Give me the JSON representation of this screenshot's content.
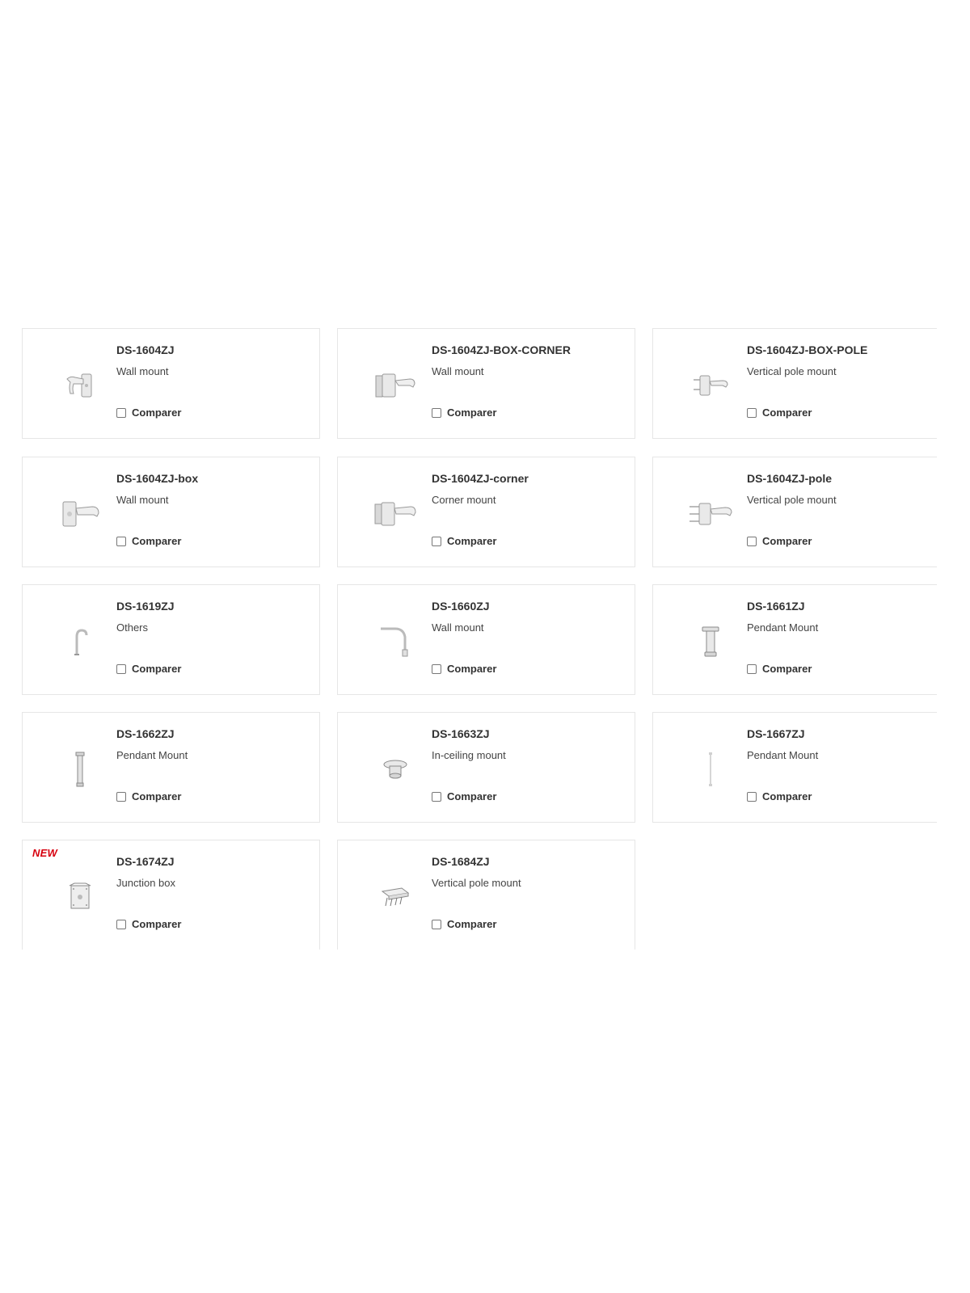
{
  "products": [
    {
      "model": "DS-1604ZJ",
      "type": "Wall mount",
      "compare_label": "Comparer",
      "icon": "wall-mount-bracket-icon"
    },
    {
      "model": "DS-1604ZJ-BOX-CORNER",
      "type": "Wall mount",
      "compare_label": "Comparer",
      "icon": "corner-box-bracket-icon"
    },
    {
      "model": "DS-1604ZJ-BOX-POLE",
      "type": "Vertical pole mount",
      "compare_label": "Comparer",
      "icon": "pole-box-bracket-icon"
    },
    {
      "model": "DS-1604ZJ-box",
      "type": "Wall mount",
      "compare_label": "Comparer",
      "icon": "wall-box-bracket-icon"
    },
    {
      "model": "DS-1604ZJ-corner",
      "type": "Corner mount",
      "compare_label": "Comparer",
      "icon": "corner-bracket-icon"
    },
    {
      "model": "DS-1604ZJ-pole",
      "type": "Vertical pole mount",
      "compare_label": "Comparer",
      "icon": "pole-bracket-icon"
    },
    {
      "model": "DS-1619ZJ",
      "type": "Others",
      "compare_label": "Comparer",
      "icon": "gooseneck-mount-icon"
    },
    {
      "model": "DS-1660ZJ",
      "type": "Wall mount",
      "compare_label": "Comparer",
      "icon": "wall-arm-mount-icon"
    },
    {
      "model": "DS-1661ZJ",
      "type": "Pendant Mount",
      "compare_label": "Comparer",
      "icon": "pendant-mount-short-icon"
    },
    {
      "model": "DS-1662ZJ",
      "type": "Pendant Mount",
      "compare_label": "Comparer",
      "icon": "pendant-mount-long-icon"
    },
    {
      "model": "DS-1663ZJ",
      "type": "In-ceiling mount",
      "compare_label": "Comparer",
      "icon": "in-ceiling-mount-icon"
    },
    {
      "model": "DS-1667ZJ",
      "type": "Pendant Mount",
      "compare_label": "Comparer",
      "icon": "pendant-rod-icon"
    },
    {
      "model": "DS-1674ZJ",
      "type": "Junction box",
      "compare_label": "Comparer",
      "icon": "junction-box-icon",
      "badge": "NEW"
    },
    {
      "model": "DS-1684ZJ",
      "type": "Vertical pole mount",
      "compare_label": "Comparer",
      "icon": "pole-mount-plate-icon"
    }
  ],
  "colors": {
    "badge": "#d7000f",
    "border": "#e6e6e6",
    "text": "#333333",
    "icon_fill": "#e9e9e9",
    "icon_stroke": "#9a9a9a"
  }
}
